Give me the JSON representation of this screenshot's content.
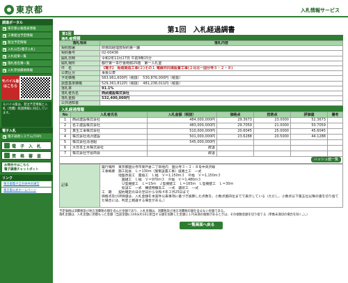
{
  "header": {
    "logo_text": "東京都",
    "service_name": "入札情報サービス"
  },
  "sidebar": {
    "section_title": "調達ポータル",
    "items": [
      "東京都公報発表情報",
      "工事発注予定情報",
      "発注予定情報",
      "入札公告(電子入札)",
      "入札結果一覧",
      "落札者名簿一覧",
      "入札参加資格情報"
    ],
    "mobile_label": "モバイル版はこちら",
    "mobile_note": "モバイル版は、発注予定情報と入札（見積）経過情報に対応しています。",
    "subhead": "電子入札",
    "big_buttons": [
      "電子調達システム(TOP)",
      "電　子　入　札",
      "資　格　審　査"
    ],
    "qa_title": "お問合せはこちら",
    "qa_sub": "電子調達チャットボット",
    "links_head": "リンク",
    "links": [
      "東京都電子自治体共同運営",
      "東京都公式ホームページ"
    ]
  },
  "main": {
    "back_label": "第1回",
    "title": "第1回　入札経過調書",
    "award_section": "落札者情報",
    "award_headers": [
      "落札項目",
      "落札内容"
    ],
    "award_rows": [
      [
        "契約部署",
        "財務局経理部契約第一課"
      ],
      [
        "契約番号",
        "02-00436"
      ],
      [
        "開札日時",
        "令和2年12月17日 午前9時15分"
      ],
      [
        "開札場所",
        "都庁第一本庁舎南側25階　第一入札室"
      ],
      [
        "件　名",
        "【電子】　街路築造工事(２)その１ 電線共同溝設置工事(２北北ー国分寺３・２・８)"
      ],
      [
        "公表区分",
        "事後公表"
      ],
      [
        "予定価格",
        "583,961,600円（税抜）　530,876,000円（税抜）"
      ],
      [
        "調査基準価格",
        "529,361,812円（税抜）　481,238,011円（税抜）"
      ],
      [
        "落札率",
        "91.1%"
      ],
      [
        "落札者氏名",
        "西武建設株式会社"
      ],
      [
        "落札金額",
        "532,400,000円"
      ],
      [
        "公共通知書",
        ""
      ]
    ],
    "bid_section": "入札経過情報",
    "bid_headers": [
      "No",
      "入札者氏名",
      "入札金額（税抜）",
      "価格点",
      "技術点",
      "評価値",
      "備考"
    ],
    "bids": [
      [
        "1",
        "西武建設株式会社",
        "484,000,000円",
        "29.3673",
        "23.0000",
        "52.3673",
        ""
      ],
      [
        "2",
        "名工建設株式会社",
        "483,000,000円",
        "29.7059",
        "21.0000",
        "50.7059",
        ""
      ],
      [
        "3",
        "真生工事株式会社",
        "510,000,000円",
        "20.6045",
        "25.0000",
        "45.6045",
        ""
      ],
      [
        "4",
        "株式会社滝沢建設",
        "501,000,000円",
        "23.6288",
        "20.5000",
        "44.1288",
        ""
      ],
      [
        "5",
        "株式会社清池組",
        "545,000,000円",
        "",
        "",
        "",
        ""
      ],
      [
        "6",
        "大日本土木株式会社",
        "辞退",
        "",
        "",
        "",
        ""
      ],
      [
        "7",
        "株式会社守谷商会",
        "辞退",
        "",
        "",
        "",
        ""
      ]
    ],
    "bid_button": "ハッシュ値一覧",
    "remark_label": "記事",
    "remark_text": "履行場所　東京都国分寺市東戸倉二丁目地内　国分寺３・２・８号中央沢線\n工事概要　施工延長　Ｌ＝130ｍ（施策設置工事）道路土工　一式\n　　　　　地盤改良工　置換工　Ｌ幅　Ｖ＝1,150ｍ３　Ｒ幅　Ｖ＝1,150ｍ３\n　　　　　　国組工　Ｌ幅　Ｖ＝970ｍ３　Ｒ幅　Ｖ＝1,480ｍ３\n　　　　　　Ｕ型擁壁工　Ｌ＝15ｍ　Ｊ型擁壁工　Ｌ＝165ｍ　Ｌ型擁壁工　Ｌ＝30ｍ\n　　　　　　仮設工　一式　構造物撤去工　一式　舗装工　一式\n工　期　　契約確定の日の翌日から令和４年２月25日まで\n価格点及び評価値は、入札金額を本案件公表事項に基づき換算した点数を、小数点第四位までで表示している（ただし、小数点以下第五位以降の値を切り捨てた場合には、判定上相違する場合がある。）",
    "footnote": "予定価格は消費税及び地方消費税の額を含んだ金額であり、入札金額は、消費税及び地方消費税の額を含まない金額である。\n落札金額は、入札金額に見積もった金額（当該金額に100分の10に相当する額を加算した金額に１円未満の端数があるときは、その端数金額を切り捨てる（単数未満切の場合を除く。）。）",
    "back_button": "一覧画面へ戻る"
  }
}
